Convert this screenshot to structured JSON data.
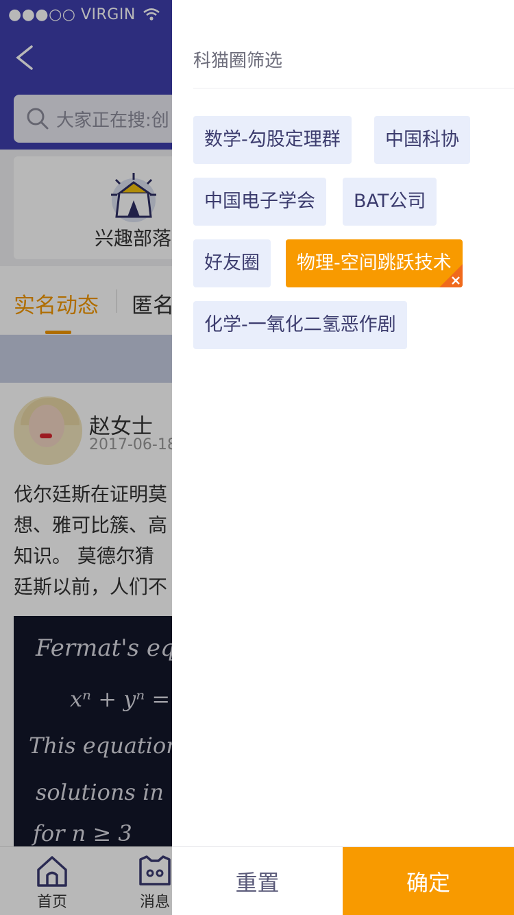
{
  "status_bar": {
    "carrier": "●●●○○ VIRGIN"
  },
  "header": {
    "search_placeholder": "大家正在搜:创"
  },
  "category": {
    "label": "兴趣部落"
  },
  "tabs": [
    {
      "label": "实名动态"
    },
    {
      "label": "匿名"
    }
  ],
  "post": {
    "author": "赵女士",
    "date": "2017-06-18",
    "lines": [
      "伐尔廷斯在证明莫",
      "想、雅可比簇、高",
      "知识。  莫德尔猜",
      "廷斯以前，人们不"
    ]
  },
  "chalkboard_lines": [
    "Fermat's eq",
    "xⁿ + yⁿ =",
    "This equation",
    "solutions in",
    "for n ≥ 3"
  ],
  "tab_bar": [
    {
      "label": "首页"
    },
    {
      "label": "消息"
    }
  ],
  "filter": {
    "title": "科猫圈筛选",
    "tags": [
      {
        "label": "数学-勾股定理群",
        "selected": false
      },
      {
        "label": "中国科协",
        "selected": false
      },
      {
        "label": "中国电子学会",
        "selected": false
      },
      {
        "label": "BAT公司",
        "selected": false
      },
      {
        "label": "好友圈",
        "selected": false
      },
      {
        "label": "物理-空间跳跃技术",
        "selected": true
      },
      {
        "label": "化学-一氧化二氢恶作剧",
        "selected": false
      }
    ],
    "reset_label": "重置",
    "confirm_label": "确定"
  },
  "colors": {
    "accent": "#f89a00",
    "header": "#3f3fae",
    "tag_bg": "#e9eefb"
  }
}
